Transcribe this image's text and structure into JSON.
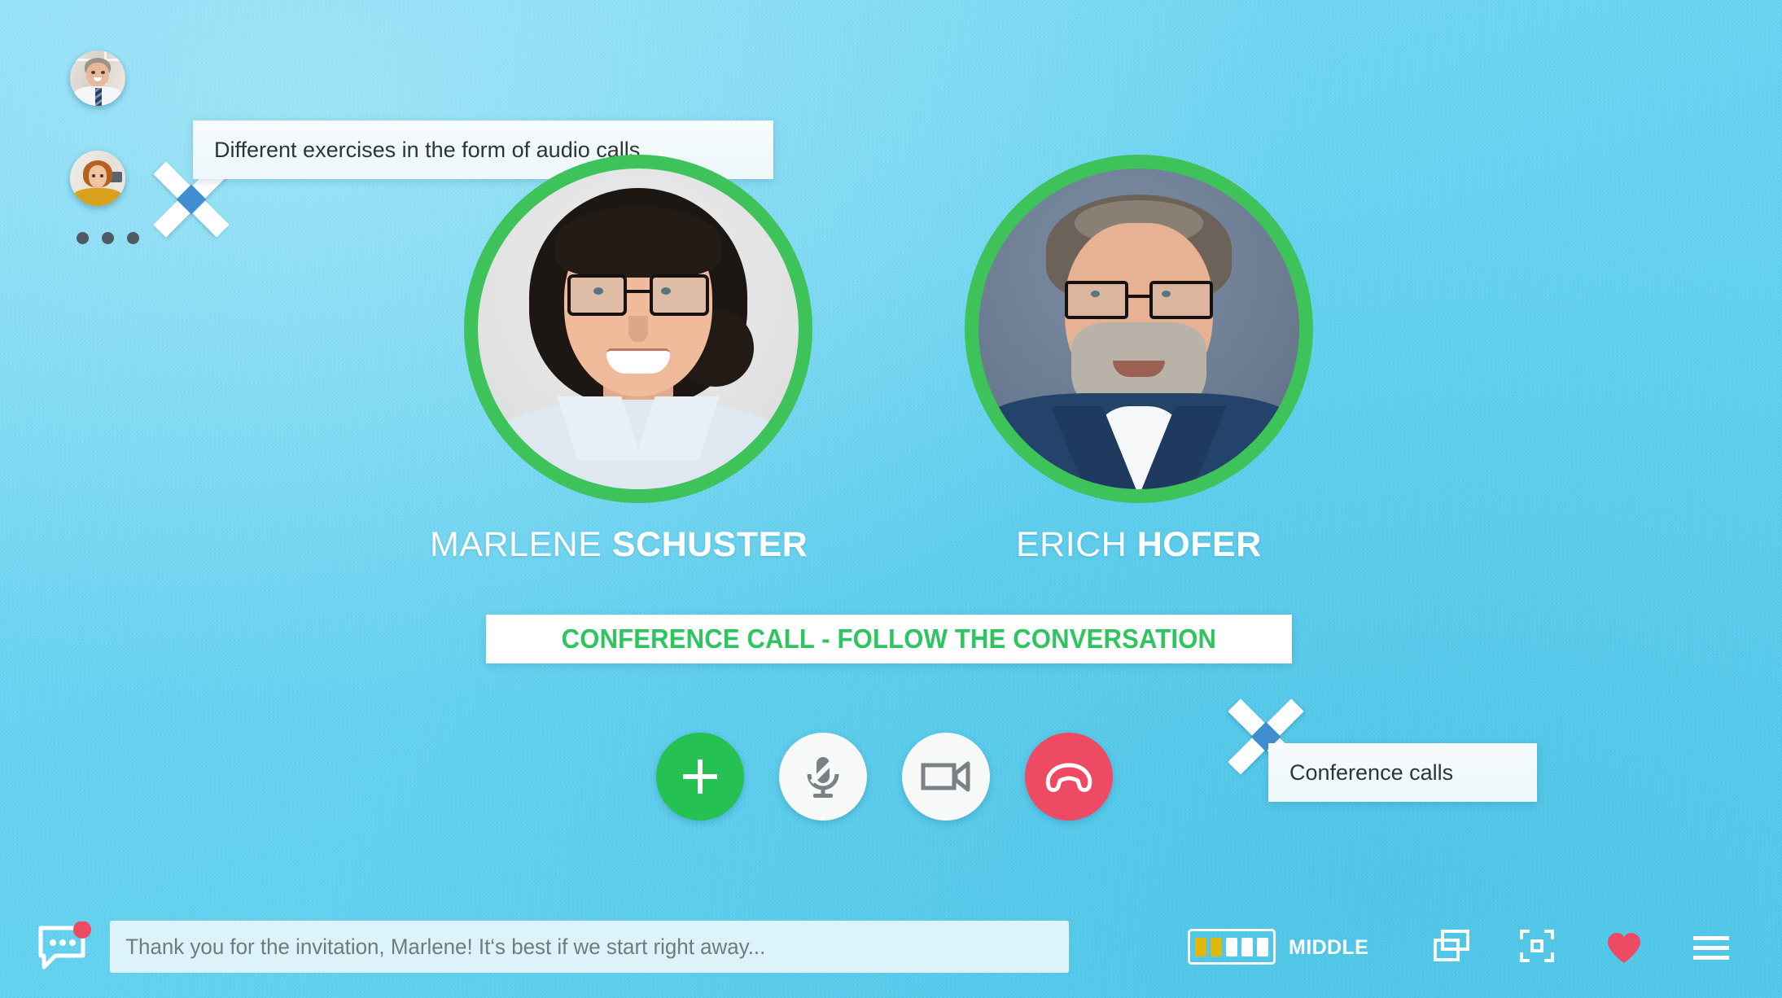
{
  "app": {
    "background_color": "#6ed2f0",
    "accent_green": "#2ec45f",
    "accent_red": "#ef4a63",
    "accent_yellow": "#e0b80c"
  },
  "sidebar": {
    "avatars": [
      {
        "name": "participant-avatar-man",
        "label": "Participant thumbnail 1"
      },
      {
        "name": "participant-avatar-woman",
        "label": "Participant thumbnail 2"
      }
    ],
    "more_indicator": "more-participants-dots"
  },
  "tooltips": [
    {
      "id": "tip-audio",
      "text": "Different exercises in the form of audio calls."
    },
    {
      "id": "tip-conf",
      "text": "Conference calls"
    }
  ],
  "participants": [
    {
      "first": "MARLENE",
      "last": "SCHUSTER",
      "status": "active",
      "ring_color": "#3dc35a"
    },
    {
      "first": "ERICH",
      "last": "HOFER",
      "status": "active",
      "ring_color": "#3dc35a"
    }
  ],
  "banner": {
    "text": "CONFERENCE CALL - FOLLOW THE CONVERSATION",
    "color": "#2ec45f"
  },
  "call_controls": [
    {
      "name": "add-participant-button",
      "icon": "plus-icon",
      "color": "#25c152"
    },
    {
      "name": "microphone-mute-button",
      "icon": "microphone-muted-icon",
      "color": "#f7f8f8"
    },
    {
      "name": "video-camera-button",
      "icon": "video-camera-icon",
      "color": "#f7f8f8"
    },
    {
      "name": "end-call-button",
      "icon": "hang-up-icon",
      "color": "#ef4a63"
    }
  ],
  "bottom_bar": {
    "chat_icon": "chat-bubble-icon",
    "chat_has_notification": true,
    "message_text": "Thank you for the invitation, Marlene! It‘s best if we start right away...",
    "message_placeholder": "Thank you for the invitation, Marlene! It‘s best if we start right away...",
    "level": {
      "label": "MIDDLE",
      "segments_total": 5,
      "segments_filled": 2
    },
    "icons": [
      {
        "name": "windowed-mode-icon",
        "label": "Windowed mode"
      },
      {
        "name": "fullscreen-icon",
        "label": "Fullscreen"
      },
      {
        "name": "favorite-heart-icon",
        "label": "Favorite"
      },
      {
        "name": "menu-hamburger-icon",
        "label": "Menu"
      }
    ]
  }
}
